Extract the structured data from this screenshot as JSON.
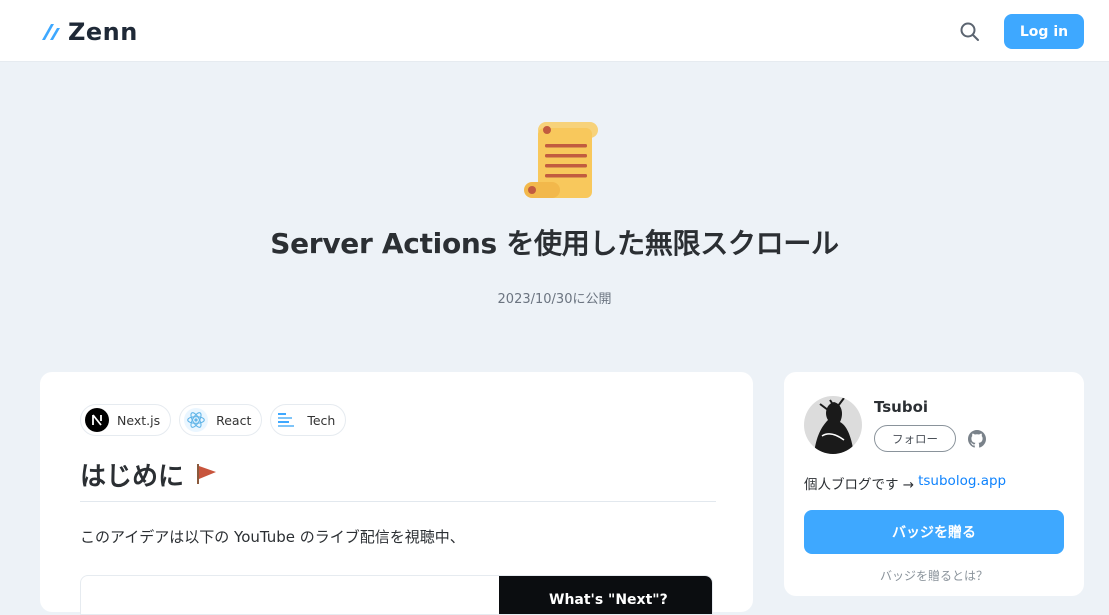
{
  "header": {
    "logo_text": "Zenn",
    "search_icon": "search-icon",
    "login_label": "Log in",
    "accent": "#3ea8ff"
  },
  "article": {
    "emoji_icon": "scroll-icon",
    "title": "Server Actions を使用した無限スクロール",
    "published": "2023/10/30に公開",
    "topics": [
      {
        "label": "Next.js",
        "icon": "nextjs-icon"
      },
      {
        "label": "React",
        "icon": "react-icon"
      },
      {
        "label": "Tech",
        "icon": "tech-icon"
      }
    ],
    "heading": "はじめに",
    "heading_icon": "flag-icon",
    "paragraph": "このアイデアは以下の YouTube のライブ配信を視聴中、",
    "embed_thumb_text": "What's \"Next\"?"
  },
  "sidebar": {
    "author_name": "Tsuboi",
    "follow_label": "フォロー",
    "bio_text": "個人ブログです →",
    "bio_link": "tsubolog.app",
    "badge_label": "バッジを贈る",
    "badge_help": "バッジを贈るとは？"
  }
}
